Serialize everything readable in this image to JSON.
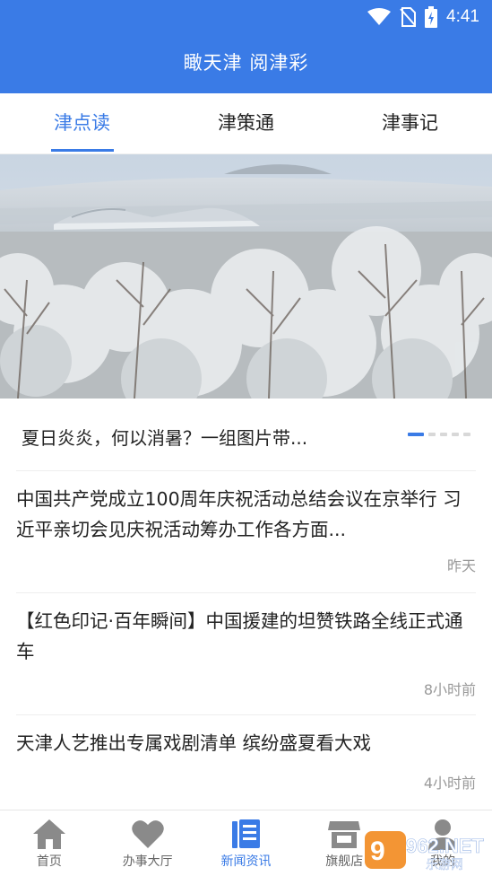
{
  "status_bar": {
    "time": "4:41"
  },
  "header": {
    "title": "瞰天津 阅津彩"
  },
  "tabs": [
    {
      "label": "津点读"
    },
    {
      "label": "津策通"
    },
    {
      "label": "津事记"
    }
  ],
  "banner": {
    "caption": "夏日炎炎，何以消暑？一组图片带...",
    "slide_count": 5,
    "active_slide": 1
  },
  "news": [
    {
      "title": "中国共产党成立100周年庆祝活动总结会议在京举行 习近平亲切会见庆祝活动筹办工作各方面...",
      "time": "昨天"
    },
    {
      "title": "【红色印记·百年瞬间】中国援建的坦赞铁路全线正式通车",
      "time": "8小时前"
    },
    {
      "title": "天津人艺推出专属戏剧清单 缤纷盛夏看大戏",
      "time": "4小时前"
    }
  ],
  "bottom_nav": [
    {
      "label": "首页",
      "icon": "home-icon"
    },
    {
      "label": "办事大厅",
      "icon": "heart-icon"
    },
    {
      "label": "新闻资讯",
      "icon": "news-icon"
    },
    {
      "label": "旗舰店",
      "icon": "store-icon"
    },
    {
      "label": "我的",
      "icon": "user-icon"
    }
  ],
  "watermark": {
    "text": "962.NET",
    "subtext": "乐游网"
  },
  "colors": {
    "primary": "#3a7be6",
    "text": "#222222",
    "muted": "#999999",
    "icon_gray": "#8a8a8a"
  }
}
